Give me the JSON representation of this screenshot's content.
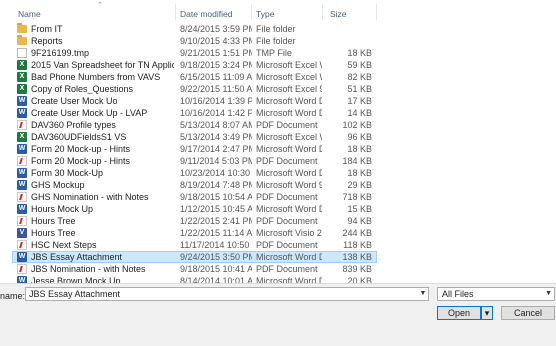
{
  "columns": {
    "name": "Name",
    "date": "Date modified",
    "type": "Type",
    "size": "Size"
  },
  "icons": {
    "folder": "folder-icon",
    "excel": "excel-file-icon",
    "word": "word-file-icon",
    "pdf": "pdf-file-icon",
    "tmp": "file-icon",
    "visio": "visio-file-icon"
  },
  "files": [
    {
      "name": "From IT",
      "date": "8/24/2015 3:59 PM",
      "type": "File folder",
      "size": "",
      "icon": "folder"
    },
    {
      "name": "Reports",
      "date": "9/10/2015 4:33 PM",
      "type": "File folder",
      "size": "",
      "icon": "folder"
    },
    {
      "name": "9F216199.tmp",
      "date": "9/21/2015 1:51 PM",
      "type": "TMP File",
      "size": "18 KB",
      "icon": "tmp"
    },
    {
      "name": "2015 Van Spreadsheet for TN Application...",
      "date": "9/18/2015 3:24 PM",
      "type": "Microsoft Excel W...",
      "size": "59 KB",
      "icon": "excel"
    },
    {
      "name": "Bad Phone Numbers from VAVS",
      "date": "6/15/2015 11:09 AM",
      "type": "Microsoft Excel W...",
      "size": "82 KB",
      "icon": "excel"
    },
    {
      "name": "Copy of Roles_Questions",
      "date": "9/22/2015 11:50 AM",
      "type": "Microsoft Excel 97...",
      "size": "51 KB",
      "icon": "excel"
    },
    {
      "name": "Create User Mock Uo",
      "date": "10/16/2014 1:39 PM",
      "type": "Microsoft Word D...",
      "size": "17 KB",
      "icon": "word"
    },
    {
      "name": "Create User Mock Up - LVAP",
      "date": "10/16/2014 1:42 PM",
      "type": "Microsoft Word D...",
      "size": "14 KB",
      "icon": "word"
    },
    {
      "name": "DAV360 Profile types",
      "date": "5/13/2014 8:07 AM",
      "type": "PDF Document",
      "size": "102 KB",
      "icon": "pdf"
    },
    {
      "name": "DAV360UDFieldsS1 VS",
      "date": "5/13/2014 3:49 PM",
      "type": "Microsoft Excel W...",
      "size": "96 KB",
      "icon": "excel"
    },
    {
      "name": "Form 20 Mock-up - Hints",
      "date": "9/17/2014 2:47 PM",
      "type": "Microsoft Word D...",
      "size": "18 KB",
      "icon": "word"
    },
    {
      "name": "Form 20 Mock-up - Hints",
      "date": "9/11/2014 5:03 PM",
      "type": "PDF Document",
      "size": "184 KB",
      "icon": "pdf"
    },
    {
      "name": "Form 30 Mock-Up",
      "date": "10/23/2014 10:30 ...",
      "type": "Microsoft Word D...",
      "size": "18 KB",
      "icon": "word"
    },
    {
      "name": "GHS Mockup",
      "date": "8/19/2014 7:48 PM",
      "type": "Microsoft Word 9...",
      "size": "29 KB",
      "icon": "word"
    },
    {
      "name": "GHS Nomination - with Notes",
      "date": "9/18/2015 10:54 AM",
      "type": "PDF Document",
      "size": "718 KB",
      "icon": "pdf"
    },
    {
      "name": "Hours Mock Up",
      "date": "1/12/2015 10:45 AM",
      "type": "Microsoft Word D...",
      "size": "15 KB",
      "icon": "word"
    },
    {
      "name": "Hours Tree",
      "date": "1/22/2015 2:41 PM",
      "type": "PDF Document",
      "size": "94 KB",
      "icon": "pdf"
    },
    {
      "name": "Hours Tree",
      "date": "1/22/2015 11:14 AM",
      "type": "Microsoft Visio 20...",
      "size": "244 KB",
      "icon": "visio"
    },
    {
      "name": "HSC Next Steps",
      "date": "11/17/2014 10:50 ...",
      "type": "PDF Document",
      "size": "118 KB",
      "icon": "pdf"
    },
    {
      "name": "JBS Essay Attachment",
      "date": "9/24/2015 3:50 PM",
      "type": "Microsoft Word D...",
      "size": "138 KB",
      "icon": "word",
      "selected": true
    },
    {
      "name": "JBS Nomination - with Notes",
      "date": "9/18/2015 10:41 AM",
      "type": "PDF Document",
      "size": "839 KB",
      "icon": "pdf"
    },
    {
      "name": "Jesse Brown Mock Up",
      "date": "8/14/2014 10:01 AM",
      "type": "Microsoft Word D...",
      "size": "20 KB",
      "icon": "word"
    }
  ],
  "filename": {
    "label": "name:",
    "value": "JBS Essay Attachment"
  },
  "filetype": {
    "value": "All Files"
  },
  "buttons": {
    "open": "Open",
    "cancel": "Cancel"
  }
}
